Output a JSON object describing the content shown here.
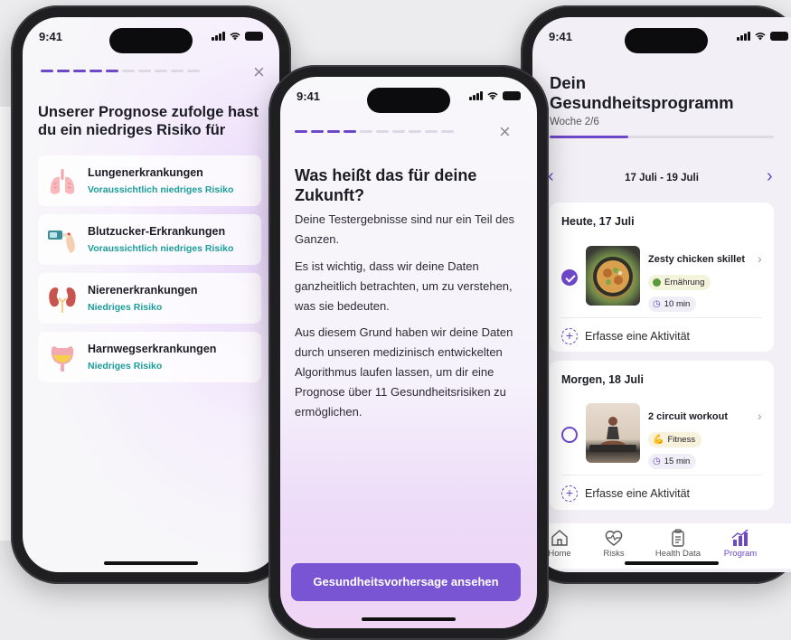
{
  "status_time": "9:41",
  "screen1": {
    "title": "Unserer Prognose zufolge hast du ein niedriges Risiko für",
    "progress_steps_done": 5,
    "progress_steps_total": 10,
    "risks": [
      {
        "name": "Lungenerkrankungen",
        "level": "Voraussichtlich niedriges Risiko",
        "icon": "lungs-icon"
      },
      {
        "name": "Blutzucker-Erkrankungen",
        "level": "Voraussichtlich niedriges Risiko",
        "icon": "glucose-meter-icon"
      },
      {
        "name": "Nierenerkrankungen",
        "level": "Niedriges Risiko",
        "icon": "kidneys-icon"
      },
      {
        "name": "Harnwegserkrankungen",
        "level": "Niedriges Risiko",
        "icon": "bladder-icon"
      }
    ]
  },
  "screen2": {
    "title": "Was heißt das für deine Zukunft?",
    "progress_steps_done": 4,
    "progress_steps_total": 10,
    "paragraphs": [
      "Deine Testergebnisse sind nur ein Teil des Ganzen.",
      "Es ist wichtig, dass wir deine Daten ganzheitlich betrachten, um zu verstehen, was sie bedeuten.",
      "Aus diesem Grund haben wir deine Daten durch unseren medizinisch entwickelten Algorithmus laufen lassen, um dir eine Prognose über 11 Gesundheitsrisiken zu ermöglichen."
    ],
    "cta_label": "Gesundheitsvorhersage ansehen"
  },
  "screen3": {
    "title": "Dein Gesundheitsprogramm",
    "week_label": "Woche 2/6",
    "week_progress": 0.35,
    "date_range": "17 Juli - 19 Juli",
    "days": [
      {
        "title": "Heute, 17 Juli",
        "done": true,
        "activity": "Zesty chicken skillet",
        "tag": "Ernährung",
        "tag_icon": "broccoli-icon",
        "duration": "10 min",
        "add_label": "Erfasse eine Aktivität"
      },
      {
        "title": "Morgen, 18 Juli",
        "done": false,
        "activity": "2 circuit workout",
        "tag": "Fitness",
        "tag_icon": "bicep-icon",
        "duration": "15 min",
        "add_label": "Erfasse eine Aktivität"
      }
    ],
    "tabs": [
      {
        "label": "Home",
        "icon": "home-icon"
      },
      {
        "label": "Risks",
        "icon": "heart-pulse-icon"
      },
      {
        "label": "Health Data",
        "icon": "clipboard-icon"
      },
      {
        "label": "Program",
        "icon": "chart-growth-icon"
      }
    ],
    "active_tab": "Program"
  },
  "colors": {
    "accent": "#6d48c9",
    "button": "#7a55d3",
    "risk_level": "#1b9e9a"
  }
}
